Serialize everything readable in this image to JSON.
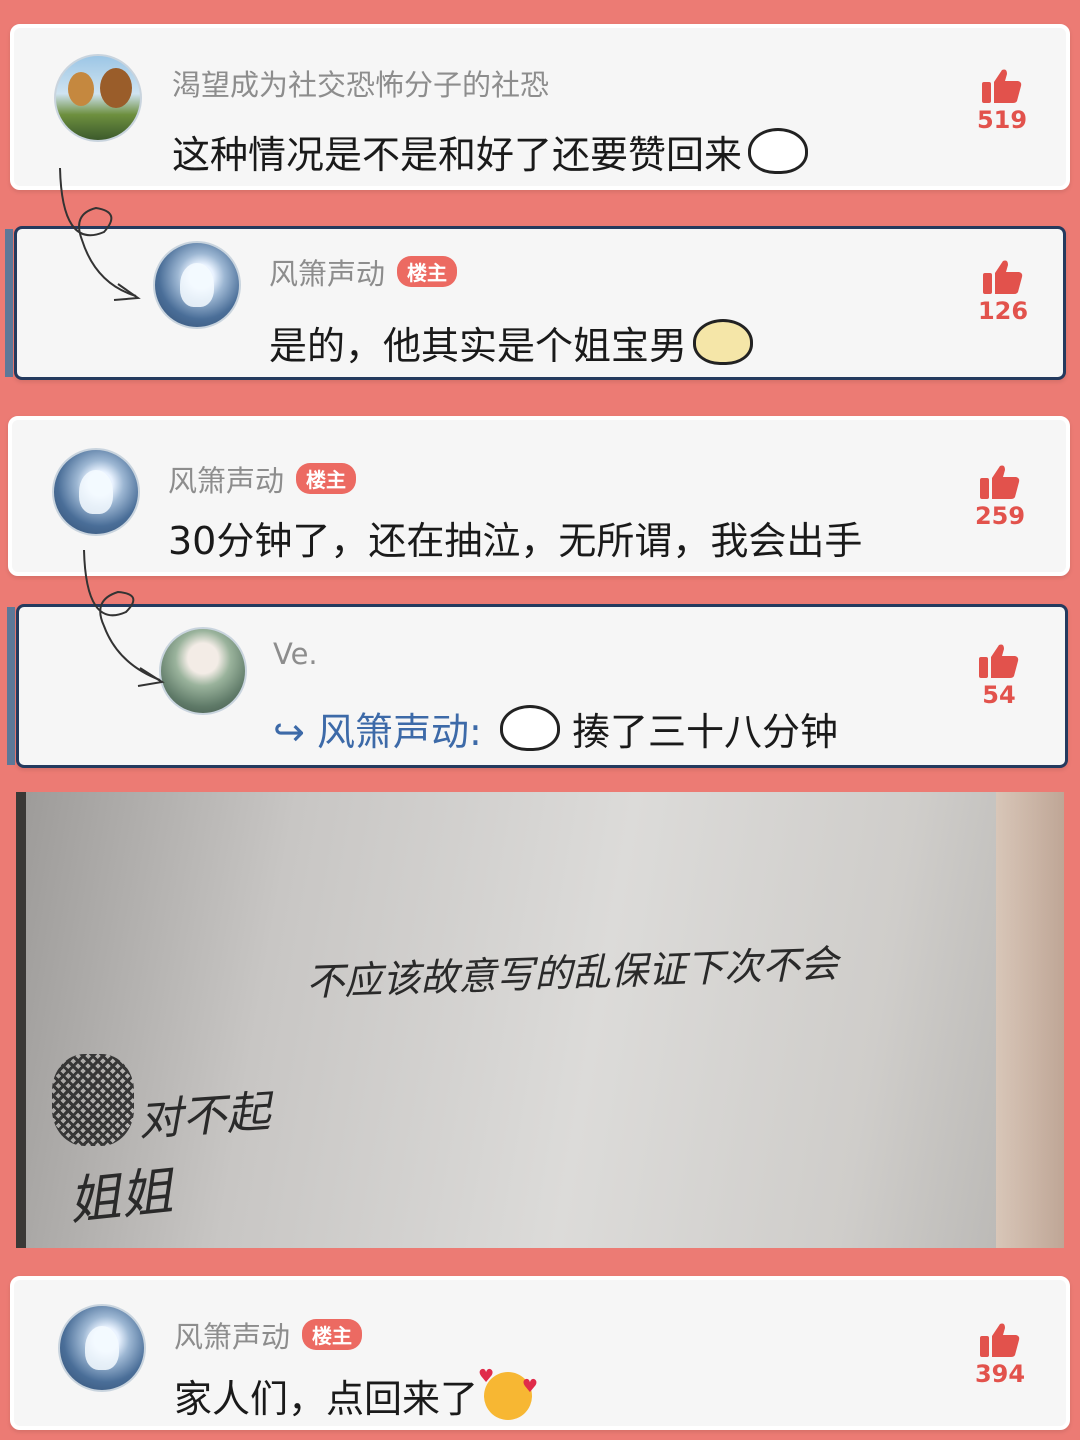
{
  "comments": [
    {
      "username": "渴望成为社交恐怖分子的社恐",
      "text": "这种情况是不是和好了还要赞回来",
      "likes": "519",
      "badge": ""
    },
    {
      "username": "风箫声动",
      "badge": "楼主",
      "text": "是的，他其实是个姐宝男",
      "likes": "126"
    },
    {
      "username": "风箫声动",
      "badge": "楼主",
      "text": "30分钟了，还在抽泣，无所谓，我会出手",
      "likes": "259"
    },
    {
      "username": "Ve.",
      "reply_to": "风箫声动:",
      "text": "揍了三十八分钟",
      "likes": "54",
      "badge": ""
    },
    {
      "username": "风箫声动",
      "badge": "楼主",
      "text": "家人们，点回来了",
      "likes": "394"
    }
  ],
  "photo": {
    "line1": "不应该故意写的乱保证下次不会",
    "line2": "对不起",
    "line3": "姐姐"
  },
  "icons": {
    "like": "thumbs-up-icon",
    "reply": "reply-arrow-icon"
  },
  "colors": {
    "background": "#ec7b74",
    "card": "#f6f6f6",
    "like": "#e2524c",
    "badge": "#ec6a62",
    "reply_link": "#3d6aa8"
  }
}
